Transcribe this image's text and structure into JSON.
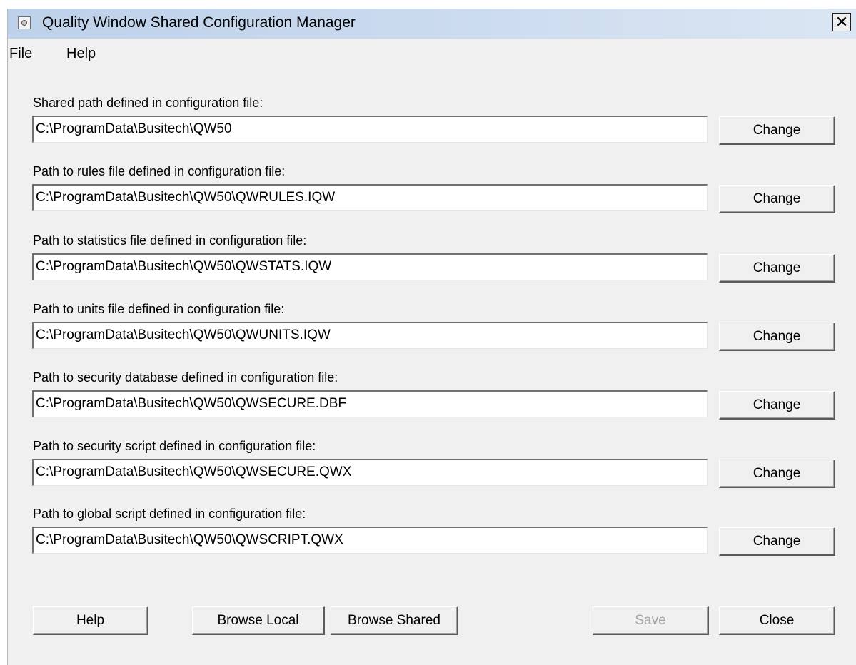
{
  "window": {
    "title": "Quality Window Shared Configuration Manager",
    "close_label": "✕"
  },
  "menu": [
    "File",
    "Help"
  ],
  "fields": [
    {
      "label": "Shared path defined in configuration file:",
      "value": "C:\\ProgramData\\Busitech\\QW50",
      "button": "Change"
    },
    {
      "label": "Path to rules file defined in configuration file:",
      "value": "C:\\ProgramData\\Busitech\\QW50\\QWRULES.IQW",
      "button": "Change"
    },
    {
      "label": "Path to statistics file defined in configuration file:",
      "value": "C:\\ProgramData\\Busitech\\QW50\\QWSTATS.IQW",
      "button": "Change"
    },
    {
      "label": "Path to units file defined in configuration file:",
      "value": "C:\\ProgramData\\Busitech\\QW50\\QWUNITS.IQW",
      "button": "Change"
    },
    {
      "label": "Path to security database defined in configuration file:",
      "value": "C:\\ProgramData\\Busitech\\QW50\\QWSECURE.DBF",
      "button": "Change"
    },
    {
      "label": "Path to security script defined in configuration file:",
      "value": "C:\\ProgramData\\Busitech\\QW50\\QWSECURE.QWX",
      "button": "Change"
    },
    {
      "label": "Path to global script defined in configuration file:",
      "value": "C:\\ProgramData\\Busitech\\QW50\\QWSCRIPT.QWX",
      "button": "Change"
    }
  ],
  "buttons": {
    "help": "Help",
    "browse_local": "Browse Local",
    "browse_shared": "Browse Shared",
    "save": "Save",
    "close": "Close"
  }
}
